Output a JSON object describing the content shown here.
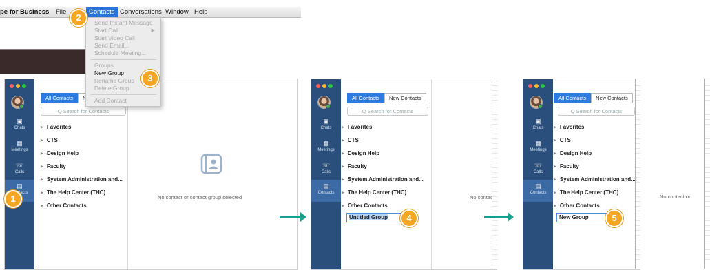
{
  "menubar": {
    "app_name": "pe for Business",
    "items": [
      "File",
      "Contacts",
      "Conversations",
      "Window",
      "Help"
    ]
  },
  "dropdown": {
    "items": [
      {
        "label": "Send Instant Message",
        "enabled": false
      },
      {
        "label": "Start Call",
        "enabled": false
      },
      {
        "label": "Start Video Call",
        "enabled": false
      },
      {
        "label": "Send Email...",
        "enabled": false
      },
      {
        "label": "Schedule Meeting...",
        "enabled": false
      },
      {
        "label": "Groups",
        "enabled": false
      },
      {
        "label": "New Group",
        "enabled": true
      },
      {
        "label": "Rename Group",
        "enabled": false
      },
      {
        "label": "Delete Group",
        "enabled": false
      },
      {
        "label": "Add Contact",
        "enabled": false
      }
    ],
    "submenu_arrow": "▶"
  },
  "nav": {
    "chats": "Chats",
    "meetings": "Meetings",
    "calls": "Calls",
    "contacts": "Contacts"
  },
  "tabs": {
    "all": "All Contacts",
    "new": "New Contacts",
    "new_truncated": "N"
  },
  "search_placeholder": "Q  Search for Contacts",
  "groups": [
    "Favorites",
    "CTS",
    "Design Help",
    "Faculty",
    "System Administration and...",
    "The Help Center (THC)",
    "Other Contacts"
  ],
  "empty_message": "No contact or contact group selected",
  "empty_fragment_1": "No contact o",
  "empty_fragment_2": "No contact or",
  "untitled_group": "Untitled Group",
  "new_group": "New Group",
  "badges": [
    "1",
    "2",
    "3",
    "4",
    "5"
  ],
  "colors": {
    "sidebar": "#2a4f7c",
    "accent": "#2d7be0",
    "badge": "#f5a623",
    "arrow": "#1aa08a"
  }
}
